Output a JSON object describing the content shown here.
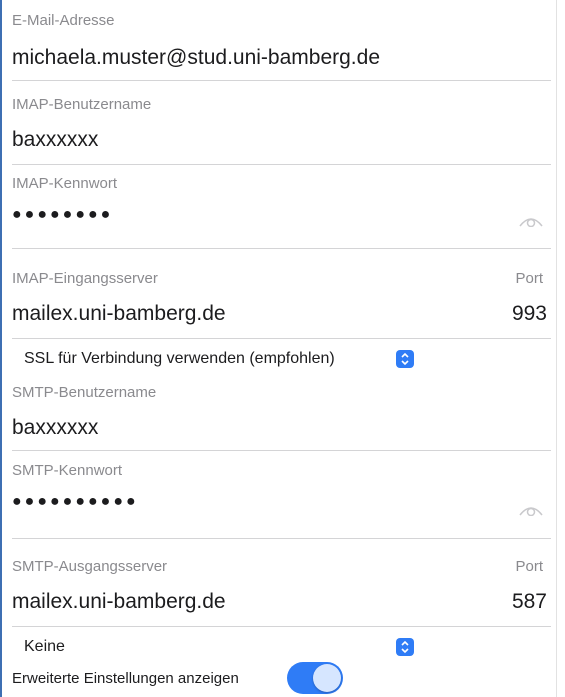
{
  "email": {
    "label": "E-Mail-Adresse",
    "value": "michaela.muster@stud.uni-bamberg.de"
  },
  "imap_user": {
    "label": "IMAP-Benutzername",
    "value": "baxxxxxx"
  },
  "imap_password": {
    "label": "IMAP-Kennwort",
    "masked": "●●●●●●●●",
    "icon": "eye-icon"
  },
  "imap_server": {
    "label": "IMAP-Eingangsserver",
    "value": "mailex.uni-bamberg.de",
    "port_label": "Port",
    "port_value": "993"
  },
  "imap_security": {
    "selected": "SSL für Verbindung verwenden (empfohlen)",
    "icon": "stepper-icon"
  },
  "smtp_user": {
    "label": "SMTP-Benutzername",
    "value": "baxxxxxx"
  },
  "smtp_password": {
    "label": "SMTP-Kennwort",
    "masked": "●●●●●●●●●●",
    "icon": "eye-icon"
  },
  "smtp_server": {
    "label": "SMTP-Ausgangsserver",
    "value": "mailex.uni-bamberg.de",
    "port_label": "Port",
    "port_value": "587"
  },
  "smtp_security": {
    "selected": "Keine",
    "icon": "stepper-icon"
  },
  "advanced": {
    "label": "Erweiterte Einstellungen anzeigen",
    "enabled": true
  },
  "colors": {
    "accent": "#2f7cf6",
    "label": "#8a8a8e",
    "divider": "#d4d4d6",
    "frame": "#3d6fb3"
  }
}
